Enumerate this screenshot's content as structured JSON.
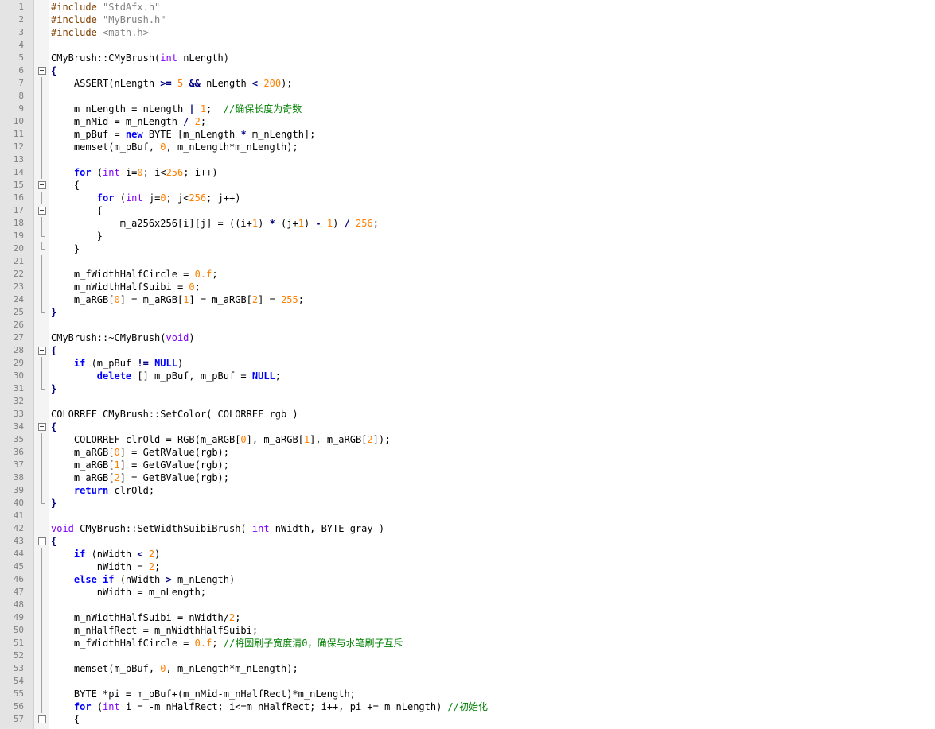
{
  "editor": {
    "lines": [
      [
        [
          "pp",
          "#include "
        ],
        [
          "str",
          "\"StdAfx.h\""
        ]
      ],
      [
        [
          "pp",
          "#include "
        ],
        [
          "str",
          "\"MyBrush.h\""
        ]
      ],
      [
        [
          "pp",
          "#include "
        ],
        [
          "str",
          "<math.h>"
        ]
      ],
      [],
      [
        [
          "t",
          "CMyBrush::CMyBrush("
        ],
        [
          "ty",
          "int"
        ],
        [
          "t",
          " nLength)"
        ]
      ],
      [
        [
          "op",
          "{"
        ]
      ],
      [
        [
          "t",
          "    ASSERT(nLength "
        ],
        [
          "op",
          ">="
        ],
        [
          "t",
          " "
        ],
        [
          "num",
          "5"
        ],
        [
          "t",
          " "
        ],
        [
          "op",
          "&&"
        ],
        [
          "t",
          " nLength "
        ],
        [
          "op",
          "<"
        ],
        [
          "t",
          " "
        ],
        [
          "num",
          "200"
        ],
        [
          "t",
          ");"
        ]
      ],
      [],
      [
        [
          "t",
          "    m_nLength = nLength "
        ],
        [
          "op",
          "|"
        ],
        [
          "t",
          " "
        ],
        [
          "num",
          "1"
        ],
        [
          "t",
          ";  "
        ],
        [
          "cm",
          "//确保长度为奇数"
        ]
      ],
      [
        [
          "t",
          "    m_nMid = m_nLength "
        ],
        [
          "op",
          "/"
        ],
        [
          "t",
          " "
        ],
        [
          "num",
          "2"
        ],
        [
          "t",
          ";"
        ]
      ],
      [
        [
          "t",
          "    m_pBuf = "
        ],
        [
          "kw",
          "new"
        ],
        [
          "t",
          " BYTE [m_nLength "
        ],
        [
          "op",
          "*"
        ],
        [
          "t",
          " m_nLength];"
        ]
      ],
      [
        [
          "t",
          "    memset(m_pBuf, "
        ],
        [
          "num",
          "0"
        ],
        [
          "t",
          ", m_nLength*m_nLength);"
        ]
      ],
      [],
      [
        [
          "t",
          "    "
        ],
        [
          "kw",
          "for"
        ],
        [
          "t",
          " ("
        ],
        [
          "ty",
          "int"
        ],
        [
          "t",
          " i="
        ],
        [
          "num",
          "0"
        ],
        [
          "t",
          "; i<"
        ],
        [
          "num",
          "256"
        ],
        [
          "t",
          "; i++)"
        ]
      ],
      [
        [
          "t",
          "    {"
        ]
      ],
      [
        [
          "t",
          "        "
        ],
        [
          "kw",
          "for"
        ],
        [
          "t",
          " ("
        ],
        [
          "ty",
          "int"
        ],
        [
          "t",
          " j="
        ],
        [
          "num",
          "0"
        ],
        [
          "t",
          "; j<"
        ],
        [
          "num",
          "256"
        ],
        [
          "t",
          "; j++)"
        ]
      ],
      [
        [
          "t",
          "        {"
        ]
      ],
      [
        [
          "t",
          "            m_a256x256[i][j] = ((i+"
        ],
        [
          "num",
          "1"
        ],
        [
          "t",
          ") "
        ],
        [
          "op",
          "*"
        ],
        [
          "t",
          " (j+"
        ],
        [
          "num",
          "1"
        ],
        [
          "t",
          ") "
        ],
        [
          "op",
          "-"
        ],
        [
          "t",
          " "
        ],
        [
          "num",
          "1"
        ],
        [
          "t",
          ") "
        ],
        [
          "op",
          "/"
        ],
        [
          "t",
          " "
        ],
        [
          "num",
          "256"
        ],
        [
          "t",
          ";"
        ]
      ],
      [
        [
          "t",
          "        }"
        ]
      ],
      [
        [
          "t",
          "    }"
        ]
      ],
      [],
      [
        [
          "t",
          "    m_fWidthHalfCircle = "
        ],
        [
          "num",
          "0.f"
        ],
        [
          "t",
          ";"
        ]
      ],
      [
        [
          "t",
          "    m_nWidthHalfSuibi = "
        ],
        [
          "num",
          "0"
        ],
        [
          "t",
          ";"
        ]
      ],
      [
        [
          "t",
          "    m_aRGB["
        ],
        [
          "num",
          "0"
        ],
        [
          "t",
          "] = m_aRGB["
        ],
        [
          "num",
          "1"
        ],
        [
          "t",
          "] = m_aRGB["
        ],
        [
          "num",
          "2"
        ],
        [
          "t",
          "] = "
        ],
        [
          "num",
          "255"
        ],
        [
          "t",
          ";"
        ]
      ],
      [
        [
          "op",
          "}"
        ]
      ],
      [],
      [
        [
          "t",
          "CMyBrush::~CMyBrush("
        ],
        [
          "ty",
          "void"
        ],
        [
          "t",
          ")"
        ]
      ],
      [
        [
          "op",
          "{"
        ]
      ],
      [
        [
          "t",
          "    "
        ],
        [
          "kw",
          "if"
        ],
        [
          "t",
          " (m_pBuf "
        ],
        [
          "op",
          "!="
        ],
        [
          "t",
          " "
        ],
        [
          "kw",
          "NULL"
        ],
        [
          "t",
          ")"
        ]
      ],
      [
        [
          "t",
          "        "
        ],
        [
          "kw",
          "delete"
        ],
        [
          "t",
          " [] m_pBuf, m_pBuf = "
        ],
        [
          "kw",
          "NULL"
        ],
        [
          "t",
          ";"
        ]
      ],
      [
        [
          "op",
          "}"
        ]
      ],
      [],
      [
        [
          "t",
          "COLORREF CMyBrush::SetColor( COLORREF rgb )"
        ]
      ],
      [
        [
          "op",
          "{"
        ]
      ],
      [
        [
          "t",
          "    COLORREF clrOld = RGB(m_aRGB["
        ],
        [
          "num",
          "0"
        ],
        [
          "t",
          "], m_aRGB["
        ],
        [
          "num",
          "1"
        ],
        [
          "t",
          "], m_aRGB["
        ],
        [
          "num",
          "2"
        ],
        [
          "t",
          "]);"
        ]
      ],
      [
        [
          "t",
          "    m_aRGB["
        ],
        [
          "num",
          "0"
        ],
        [
          "t",
          "] = GetRValue(rgb);"
        ]
      ],
      [
        [
          "t",
          "    m_aRGB["
        ],
        [
          "num",
          "1"
        ],
        [
          "t",
          "] = GetGValue(rgb);"
        ]
      ],
      [
        [
          "t",
          "    m_aRGB["
        ],
        [
          "num",
          "2"
        ],
        [
          "t",
          "] = GetBValue(rgb);"
        ]
      ],
      [
        [
          "t",
          "    "
        ],
        [
          "kw",
          "return"
        ],
        [
          "t",
          " clrOld;"
        ]
      ],
      [
        [
          "op",
          "}"
        ]
      ],
      [],
      [
        [
          "ty",
          "void"
        ],
        [
          "t",
          " CMyBrush::SetWidthSuibiBrush( "
        ],
        [
          "ty",
          "int"
        ],
        [
          "t",
          " nWidth, BYTE gray )"
        ]
      ],
      [
        [
          "op",
          "{"
        ]
      ],
      [
        [
          "t",
          "    "
        ],
        [
          "kw",
          "if"
        ],
        [
          "t",
          " (nWidth "
        ],
        [
          "op",
          "<"
        ],
        [
          "t",
          " "
        ],
        [
          "num",
          "2"
        ],
        [
          "t",
          ")"
        ]
      ],
      [
        [
          "t",
          "        nWidth = "
        ],
        [
          "num",
          "2"
        ],
        [
          "t",
          ";"
        ]
      ],
      [
        [
          "t",
          "    "
        ],
        [
          "kw",
          "else if"
        ],
        [
          "t",
          " (nWidth "
        ],
        [
          "op",
          ">"
        ],
        [
          "t",
          " m_nLength)"
        ]
      ],
      [
        [
          "t",
          "        nWidth = m_nLength;"
        ]
      ],
      [],
      [
        [
          "t",
          "    m_nWidthHalfSuibi = nWidth/"
        ],
        [
          "num",
          "2"
        ],
        [
          "t",
          ";"
        ]
      ],
      [
        [
          "t",
          "    m_nHalfRect = m_nWidthHalfSuibi;"
        ]
      ],
      [
        [
          "t",
          "    m_fWidthHalfCircle = "
        ],
        [
          "num",
          "0.f"
        ],
        [
          "t",
          "; "
        ],
        [
          "cm",
          "//将圆刷子宽度清0，确保与水笔刷子互斥"
        ]
      ],
      [],
      [
        [
          "t",
          "    memset(m_pBuf, "
        ],
        [
          "num",
          "0"
        ],
        [
          "t",
          ", m_nLength*m_nLength);"
        ]
      ],
      [],
      [
        [
          "t",
          "    BYTE *pi = m_pBuf+(m_nMid-m_nHalfRect)*m_nLength;"
        ]
      ],
      [
        [
          "t",
          "    "
        ],
        [
          "kw",
          "for"
        ],
        [
          "t",
          " ("
        ],
        [
          "ty",
          "int"
        ],
        [
          "t",
          " i = -m_nHalfRect; i<=m_nHalfRect; i++, pi += m_nLength) "
        ],
        [
          "cm",
          "//初始化"
        ]
      ],
      [
        [
          "t",
          "    {"
        ]
      ]
    ],
    "folds": [
      "",
      "",
      "",
      "",
      "",
      "box",
      "vline",
      "vline",
      "vline",
      "vline",
      "vline",
      "vline",
      "vline",
      "vline",
      "box",
      "vline",
      "box",
      "vline",
      "end",
      "end",
      "vline",
      "vline",
      "vline",
      "vline",
      "end",
      "",
      "",
      "box",
      "vline",
      "vline",
      "end",
      "",
      "",
      "box",
      "vline",
      "vline",
      "vline",
      "vline",
      "vline",
      "end",
      "",
      "",
      "box",
      "vline",
      "vline",
      "vline",
      "vline",
      "vline",
      "vline",
      "vline",
      "vline",
      "vline",
      "vline",
      "vline",
      "vline",
      "vline",
      "box"
    ]
  }
}
